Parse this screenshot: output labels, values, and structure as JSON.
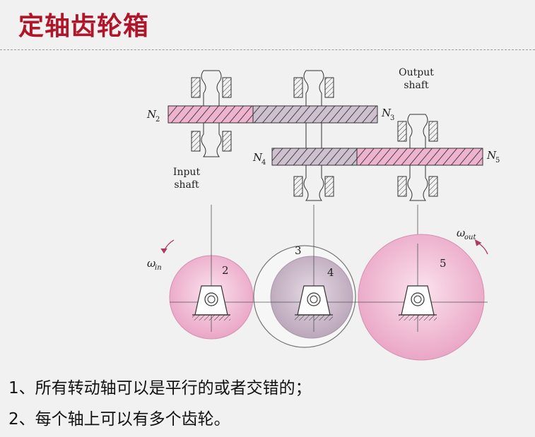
{
  "title": "定轴齿轮箱",
  "labels": {
    "output_shaft_line1": "Output",
    "output_shaft_line2": "shaft",
    "input_shaft_line1": "Input",
    "input_shaft_line2": "shaft",
    "n2": "N",
    "n2_sub": "2",
    "n3": "N",
    "n3_sub": "3",
    "n4": "N",
    "n4_sub": "4",
    "n5": "N",
    "n5_sub": "5",
    "omega_in": "ω",
    "omega_in_sub": "in",
    "omega_out": "ω",
    "omega_out_sub": "out",
    "gear2": "2",
    "gear3": "3",
    "gear4": "4",
    "gear5": "5"
  },
  "bullets": [
    "1、所有转动轴可以是平行的或者交错的；",
    "2、每个轴上可以有多个齿轮。"
  ],
  "colors": {
    "title": "#b0162a",
    "gear_pink": "#f0b8d2",
    "gear_purple": "#cdbccb",
    "line": "#333333"
  }
}
